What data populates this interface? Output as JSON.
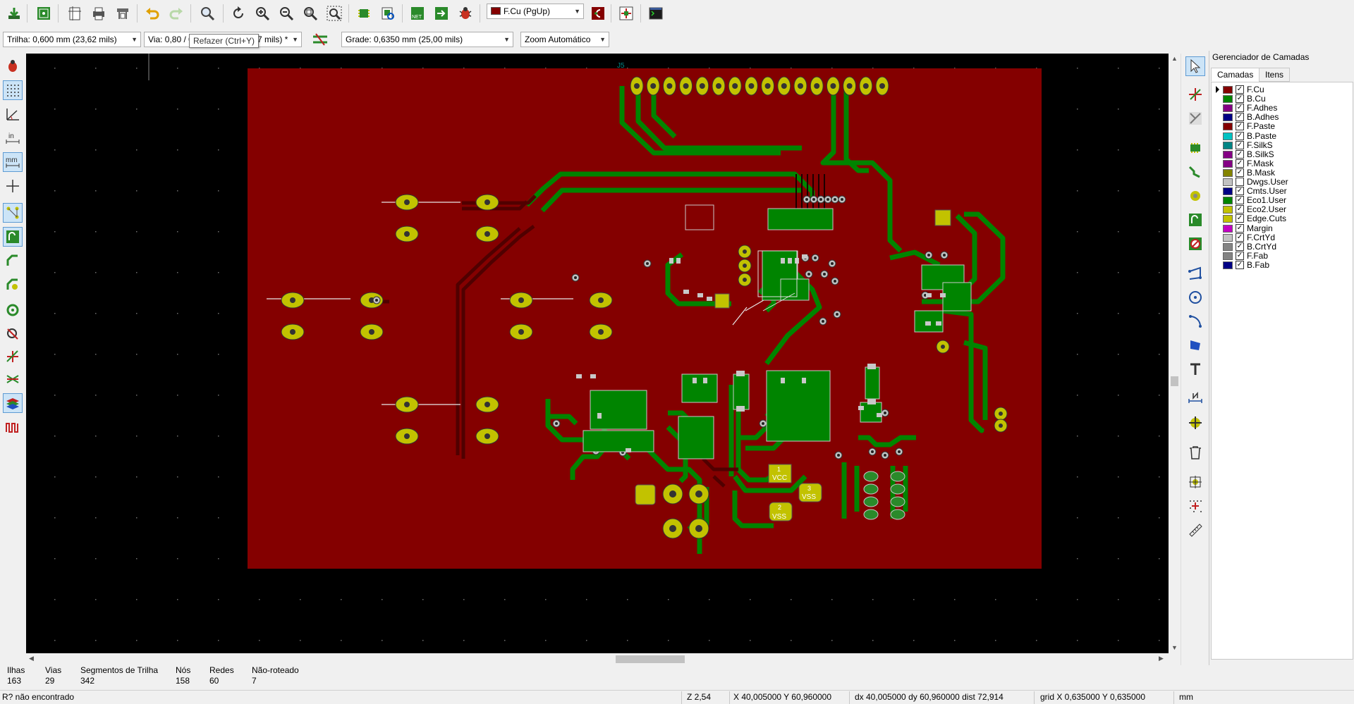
{
  "toolbar": {
    "active_layer": "F.Cu (PgUp)",
    "active_layer_color": "#840000",
    "buttons": [
      "save-board",
      "board-setup",
      "page-settings",
      "print",
      "plot",
      "undo",
      "redo",
      "find",
      "redraw",
      "zoom-in",
      "zoom-out",
      "zoom-fit",
      "zoom-selection",
      "footprint-editor",
      "footprint-browser",
      "read-netlist",
      "update-from-schematic",
      "drc",
      "select-layer-pair",
      "microwave",
      "scripting-console"
    ]
  },
  "aux_toolbar": {
    "track": "Trilha: 0,600 mm (23,62 mils)",
    "via": "Via: 0,80 / 0",
    "via_suffix": "7 mils) *",
    "grid": "Grade: 0,6350 mm (25,00 mils)",
    "zoom": "Zoom Automático",
    "tooltip": "Refazer (Ctrl+Y)"
  },
  "left_toolbar": [
    "drc-off",
    "grid",
    "polar-coords",
    "inch-units",
    "mm-units",
    "full-crosshair",
    "show-ratsnest",
    "zone-fill-display",
    "track-display",
    "via-display",
    "pad-display",
    "high-contrast",
    "net-highlight",
    "layer-manager",
    "microwave-toolbar"
  ],
  "right_toolbar": [
    "select",
    "highlight-net",
    "local-ratsnest",
    "add-footprint",
    "route-track",
    "add-via",
    "add-zone",
    "add-keepout",
    "add-line",
    "add-circle",
    "add-arc",
    "add-polygon",
    "add-text",
    "add-dimension",
    "add-target",
    "delete",
    "set-origin",
    "set-grid-origin",
    "measure"
  ],
  "layers_panel": {
    "title": "Gerenciador de Camadas",
    "tabs": [
      "Camadas",
      "Itens"
    ],
    "layers": [
      {
        "name": "F.Cu",
        "color": "#840000",
        "checked": true,
        "active": true
      },
      {
        "name": "B.Cu",
        "color": "#008400",
        "checked": true
      },
      {
        "name": "F.Adhes",
        "color": "#840084",
        "checked": true
      },
      {
        "name": "B.Adhes",
        "color": "#000084",
        "checked": true
      },
      {
        "name": "F.Paste",
        "color": "#840000",
        "checked": true
      },
      {
        "name": "B.Paste",
        "color": "#00c2c2",
        "checked": true
      },
      {
        "name": "F.SilkS",
        "color": "#008484",
        "checked": true
      },
      {
        "name": "B.SilkS",
        "color": "#840084",
        "checked": true
      },
      {
        "name": "F.Mask",
        "color": "#840084",
        "checked": true
      },
      {
        "name": "B.Mask",
        "color": "#848400",
        "checked": true
      },
      {
        "name": "Dwgs.User",
        "color": "#c2c2c2",
        "checked": false
      },
      {
        "name": "Cmts.User",
        "color": "#000084",
        "checked": true
      },
      {
        "name": "Eco1.User",
        "color": "#008400",
        "checked": true
      },
      {
        "name": "Eco2.User",
        "color": "#c2c200",
        "checked": true
      },
      {
        "name": "Edge.Cuts",
        "color": "#c2c200",
        "checked": true
      },
      {
        "name": "Margin",
        "color": "#c200c2",
        "checked": true
      },
      {
        "name": "F.CrtYd",
        "color": "#c2c2c2",
        "checked": true
      },
      {
        "name": "B.CrtYd",
        "color": "#848484",
        "checked": true
      },
      {
        "name": "F.Fab",
        "color": "#848484",
        "checked": true
      },
      {
        "name": "B.Fab",
        "color": "#000084",
        "checked": true
      }
    ]
  },
  "board": {
    "ref_label": "J5",
    "pad_labels": [
      {
        "num": "1",
        "net": "VCC"
      },
      {
        "num": "2",
        "net": "VSS"
      },
      {
        "num": "3",
        "net": "VSS"
      }
    ],
    "colors": {
      "background": "#000000",
      "copper_front": "#840000",
      "copper_back": "#008400",
      "pad": "#c2c200",
      "silkscreen": "#e0e0e0"
    }
  },
  "stats": [
    {
      "label": "Ilhas",
      "value": "163"
    },
    {
      "label": "Vias",
      "value": "29"
    },
    {
      "label": "Segmentos de Trilha",
      "value": "342"
    },
    {
      "label": "Nós",
      "value": "158"
    },
    {
      "label": "Redes",
      "value": "60"
    },
    {
      "label": "Não-roteado",
      "value": "7"
    }
  ],
  "status_bar": {
    "message": "R? não encontrado",
    "zoom": "Z 2,54",
    "abs_coords": "X 40,005000  Y 60,960000",
    "rel_coords": "dx 40,005000  dy 60,960000  dist 72,914",
    "grid": "grid X 0,635000  Y 0,635000",
    "units": "mm"
  }
}
